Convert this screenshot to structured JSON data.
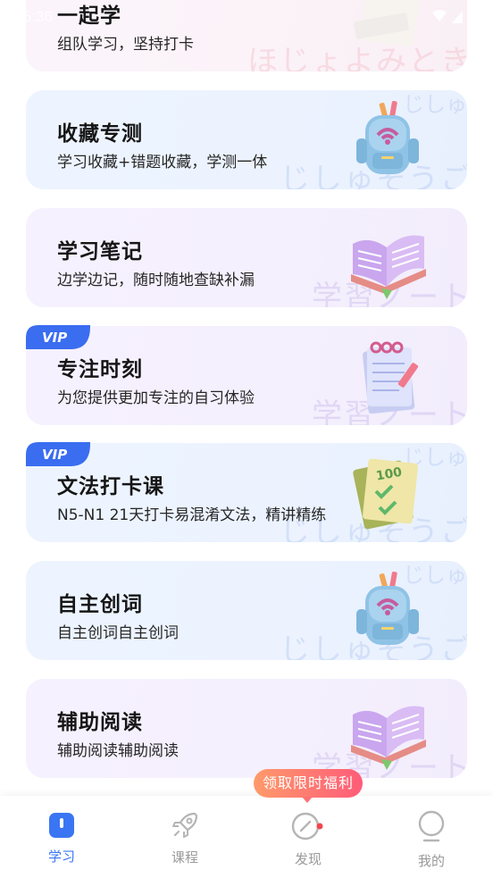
{
  "status": {
    "time": "5:36"
  },
  "cards": [
    {
      "title": "一起学",
      "subtitle": "组队学习，坚持打卡",
      "watermark": "ほじょよみとき",
      "vip": false
    },
    {
      "title": "收藏专测",
      "subtitle": "学习收藏+错题收藏，学测一体",
      "watermark": "じしゅそうご",
      "vip": false
    },
    {
      "title": "学习笔记",
      "subtitle": "边学边记，随时随地查缺补漏",
      "watermark": "学習ノート",
      "vip": false
    },
    {
      "title": "专注时刻",
      "subtitle": "为您提供更加专注的自习体验",
      "watermark": "学習ノート",
      "vip": true,
      "badge": "VIP"
    },
    {
      "title": "文法打卡课",
      "subtitle": "N5-N1 21天打卡易混淆文法，精讲精练",
      "watermark": "じしゅそうご",
      "vip": true,
      "badge": "VIP"
    },
    {
      "title": "自主创词",
      "subtitle": "自主创词自主创词",
      "watermark": "じしゅそうご",
      "vip": false
    },
    {
      "title": "辅助阅读",
      "subtitle": "辅助阅读辅助阅读",
      "watermark": "学習ノート",
      "vip": false
    }
  ],
  "promo": {
    "label": "领取限时福利"
  },
  "nav": {
    "items": [
      {
        "label": "学习",
        "icon": "study-icon",
        "active": true
      },
      {
        "label": "课程",
        "icon": "rocket-icon",
        "active": false
      },
      {
        "label": "发现",
        "icon": "compass-icon",
        "active": false,
        "dot": true
      },
      {
        "label": "我的",
        "icon": "profile-icon",
        "active": false
      }
    ]
  },
  "colors": {
    "accent": "#3a76f3",
    "promo_start": "#ff9a6b",
    "promo_end": "#ff5c78",
    "inactive": "#999999"
  }
}
